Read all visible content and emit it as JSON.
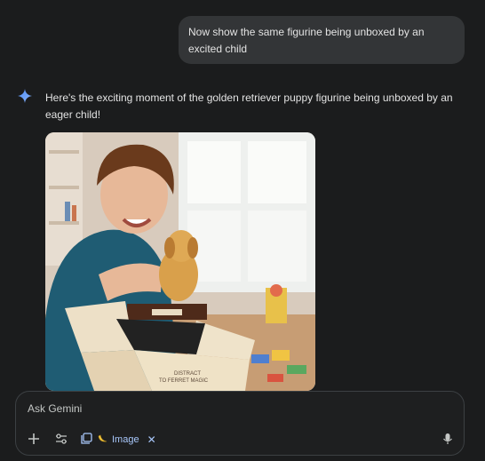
{
  "conversation": {
    "user_message": "Now show the same figurine being unboxed by an excited child",
    "assistant_message": "Here's the exciting moment of the golden retriever puppy figurine being unboxed by an eager child!",
    "assistant_icon": "gemini-spark-icon",
    "image_box_text": [
      "DISTRACT",
      "TO FERRET MAGIC"
    ]
  },
  "input": {
    "placeholder": "Ask Gemini",
    "tool_chip_label": "Image",
    "icons": [
      "plus-icon",
      "tools-icon",
      "image-gallery-icon",
      "banana-icon",
      "close-icon",
      "microphone-icon"
    ]
  },
  "colors": {
    "background": "#1b1c1d",
    "bubble": "#333537",
    "accent": "#a8c7fa"
  }
}
